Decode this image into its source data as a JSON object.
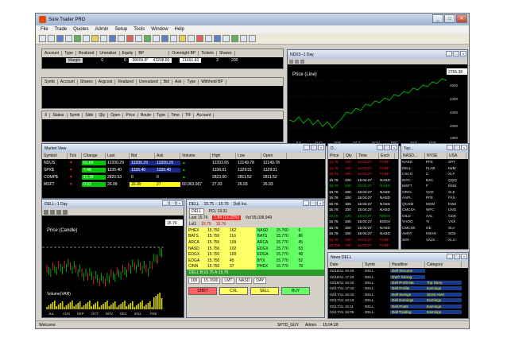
{
  "app": {
    "title": "Sure Trader PRO",
    "status_left": "Welcome",
    "status_user": "SPTD_GUY",
    "status_role": "Admin",
    "status_time": "15:04:28"
  },
  "menu": [
    "File",
    "Trade",
    "Quotes",
    "Admin",
    "Setup",
    "Tools",
    "Window",
    "Help"
  ],
  "account": {
    "headers": [
      "Account",
      "Type",
      "Realized",
      "Unrealize",
      "Equity",
      "BP",
      "Overnight BP",
      "Tickets",
      "Shares"
    ],
    "row": [
      "",
      "Margin",
      "0",
      "0",
      "-38659.8*",
      "43208.80",
      "21691.83",
      "2",
      "200"
    ]
  },
  "positions": {
    "headers": [
      "Symb",
      "Account",
      "Shares",
      "Avgcost",
      "Realized",
      "Unrealized",
      "Bid",
      "Ask",
      "Type",
      "Withheld BP"
    ]
  },
  "orders": {
    "headers": [
      "X",
      "Status",
      "Symb",
      "Side",
      "Qty",
      "Open",
      "Price",
      "Route",
      "Type",
      "Time",
      "TIF",
      "Account"
    ]
  },
  "nodx_chart": {
    "title": "NDX3--1 Day",
    "label": "Price (Line)",
    "last_price": "2755.38",
    "x_labels": [
      "JUL",
      "AUG",
      "SEP",
      "OCT",
      "NOV",
      "DEC",
      "2011",
      "FEB"
    ],
    "y_labels": [
      "2600",
      "2400",
      "2200",
      "2000",
      "1800"
    ]
  },
  "market_view": {
    "title": "Market View",
    "headers": [
      "Symbol",
      "Tick",
      "Change",
      "Last",
      "Bid",
      "Ask",
      "Volume",
      "High",
      "Low",
      "Open"
    ],
    "rows": [
      [
        "NDUS",
        "▼",
        "61.65",
        "12200.29",
        "12200.29",
        "12200.29",
        "▲",
        "12203.65",
        "12149.78",
        "12149.78"
      ],
      [
        "SPX$",
        "▼",
        "7.48",
        "1335.40",
        "1335.40",
        "1335.40",
        "▲",
        "1336.01",
        "1329.01",
        "1329.01"
      ],
      [
        "COMP$",
        "▼",
        "21.18",
        "2820.53",
        "0",
        "0",
        "▲",
        "2823.00",
        "2811.52",
        "2811.52"
      ],
      [
        "MSFT",
        "▼",
        "0.03",
        "26.99",
        "26.99",
        "27",
        "60,963,067",
        "27.03",
        "26.93",
        "26.93"
      ]
    ]
  },
  "time_sales": {
    "title": "D...",
    "headers": [
      "Price",
      "Qty",
      "Time",
      "Exch"
    ],
    "rows": [
      [
        "15.76",
        "100",
        "15:04:27",
        "FADF"
      ],
      [
        "15.76",
        "100",
        "15:04:27",
        "FADF"
      ],
      [
        "15.76",
        "100",
        "15:04:27",
        "FADF"
      ],
      [
        "15.76",
        "100",
        "15:04:27",
        "NASD"
      ],
      [
        "15.78",
        "100",
        "15:04:27",
        "NASD"
      ],
      [
        "15.76",
        "100",
        "15:04:27",
        "NASD"
      ],
      [
        "15.76",
        "100",
        "15:04:27",
        "NASD"
      ],
      [
        "15.76",
        "100",
        "15:04:27",
        "NASD"
      ],
      [
        "15.76",
        "100",
        "15:04:27",
        "NASD"
      ],
      [
        "15.78",
        "100",
        "15:04:27",
        "EDGX"
      ],
      [
        "15.75",
        "100",
        "15:04:27",
        "EDGA"
      ],
      [
        "15.76",
        "100",
        "15:04:27",
        "NASD"
      ],
      [
        "15.76",
        "100",
        "15:04:27",
        "NASD"
      ],
      [
        "15.76",
        "100",
        "15:04:27",
        "FADF"
      ],
      [
        "15.755",
        "100",
        "15:04:27",
        "FADF"
      ],
      [
        "15.78",
        "100",
        "15:04:27",
        "FADF"
      ]
    ]
  },
  "top_list": {
    "title": "Top...",
    "headers": [
      "NASD...",
      "NYSE",
      "USA"
    ],
    "rows": [
      [
        "NASD",
        "PFE",
        "SPY"
      ],
      [
        "DELL",
        "FLAB",
        "IWM"
      ],
      [
        "CSCO",
        "C",
        "XLF"
      ],
      [
        "INTC",
        "BAC",
        "QQQ"
      ],
      [
        "MSFT",
        "F",
        "EEM"
      ],
      [
        "ORCL",
        "VOX",
        "XLE"
      ],
      [
        "AAPL",
        "PFE",
        "FAS"
      ],
      [
        "QCOM",
        "MGM",
        "EWZ"
      ],
      [
        "CMCSA",
        "WFC",
        "UNG"
      ],
      [
        "GILD",
        "AAL",
        "GDX"
      ],
      [
        "YHOO",
        "TI",
        "VXX"
      ],
      [
        "CMCSK",
        "GE",
        "SLV"
      ],
      [
        "AMAT",
        "HBAN",
        "SDS"
      ],
      [
        "SIRI",
        "VALE",
        "XLU"
      ]
    ]
  },
  "dell_chart": {
    "title": "DELL--1 Day",
    "label": "Price (Candle)",
    "last_price": "15.76",
    "x_labels": [
      "JUL",
      "AUG",
      "SEP",
      "OCT",
      "NOV",
      "DEC",
      "2011",
      "FEB"
    ],
    "volume_label": "Volume(VAR)"
  },
  "level2": {
    "title": "DELL",
    "header_bar": "15.75 -- 15.76",
    "company": "Dell Inc.",
    "pcl": "PCL 13.31",
    "last_label": "Last 15.76",
    "change": "1.84 (13.22%)",
    "volume": "Vol 55,038,949",
    "lvl_label": "Lvl1",
    "bid": "15.75",
    "ask": "15.76",
    "bid_rows": [
      [
        "PHEX",
        "15.750",
        "162"
      ],
      [
        "BATS",
        "15.750",
        "116"
      ],
      [
        "ARCA",
        "15.750",
        "109"
      ],
      [
        "NASD",
        "15.750",
        "102"
      ],
      [
        "EDGX",
        "15.750",
        "100"
      ],
      [
        "EDGA",
        "15.750",
        "45"
      ],
      [
        "CINN",
        "15.750",
        "37"
      ]
    ],
    "ask_rows": [
      [
        "NASD",
        "15.760",
        "6"
      ],
      [
        "BATS",
        "15.770",
        "86"
      ],
      [
        "ARCA",
        "15.770",
        "45"
      ],
      [
        "EDGX",
        "15.770",
        "53"
      ],
      [
        "EDGA",
        "15.770",
        "48"
      ],
      [
        "BYX",
        "15.770",
        "52"
      ],
      [
        "PHEX",
        "15.770",
        "78"
      ]
    ],
    "status": "DELL B:15.75 A:15.76",
    "qty": "100",
    "price": "15.7600",
    "type": "LMT",
    "route": "NASD",
    "tif": "DAY",
    "buttons": [
      "SHRT",
      "CXL",
      "SELL",
      "BUY"
    ]
  },
  "news": {
    "title": "News DELL",
    "headers": [
      "Date",
      "Symb",
      "Headline",
      "Category"
    ],
    "rows": [
      [
        "02/18/11 16:40",
        "DELL",
        "Dell Secures",
        ""
      ],
      [
        "02/18/11 17:42",
        "DELL",
        "DWT Strong",
        ""
      ],
      [
        "02/18/11 16:40",
        "DELL",
        "Dell Profit Ma",
        "Top Story"
      ],
      [
        "02/17/11 17:33",
        "DELL",
        "Dell Profits",
        "Earnings"
      ],
      [
        "02/17/11 16:33",
        "DELL",
        "Dell Swings",
        "Stock Alert"
      ],
      [
        "02/17/11 16:19",
        "DELL",
        "Dell Earnings",
        "Earnings"
      ],
      [
        "02/17/11 16:11",
        "DELL",
        "Dell Posts",
        "Earnings"
      ],
      [
        "02/17/11 16:05",
        "DELL",
        "Dell Trading",
        "Earnings"
      ]
    ]
  },
  "colors": {
    "up": "#00c800",
    "down": "#ff2020",
    "highlight": "#ffff00",
    "bid_bg": "#ffff66",
    "ask_bg": "#66ff66"
  }
}
